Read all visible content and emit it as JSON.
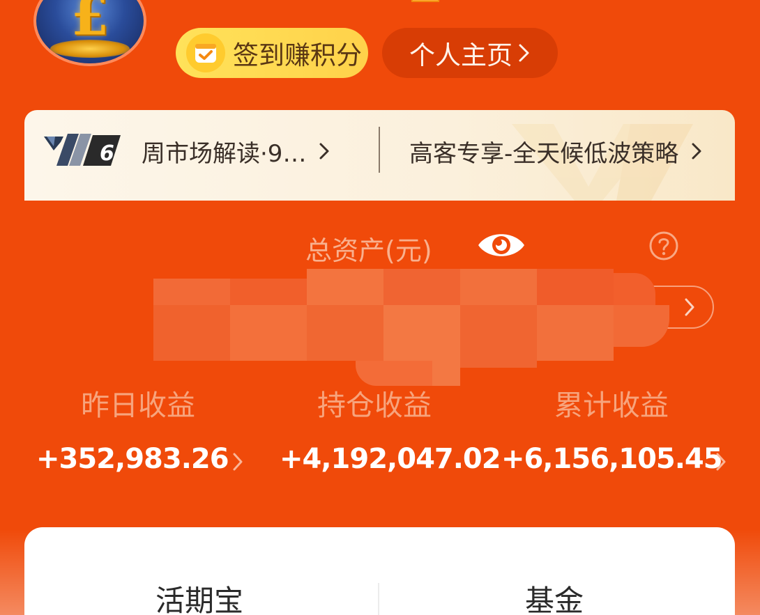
{
  "header": {
    "checkin_label": "签到赚积分",
    "profile_label": "个人主页"
  },
  "banner": {
    "badge_level": "6",
    "item1_text": "周市场解读·9…",
    "item2_text": "高客专享-全天候低波策略"
  },
  "assets": {
    "label": "总资产(元)"
  },
  "earnings": [
    {
      "label": "昨日收益",
      "value": "+352,983.26"
    },
    {
      "label": "持仓收益",
      "value": "+4,192,047.02"
    },
    {
      "label": "累计收益",
      "value": "+6,156,105.45"
    }
  ],
  "bottom_tabs": [
    {
      "label": "活期宝"
    },
    {
      "label": "基金"
    }
  ],
  "colors": {
    "background": "#f04a0a",
    "checkin_bg": "#ffdf55",
    "profile_bg": "#d83d05",
    "banner_bg": "#fbf2e2",
    "label_muted": "#f7a47d",
    "value_text": "#ffffff"
  }
}
